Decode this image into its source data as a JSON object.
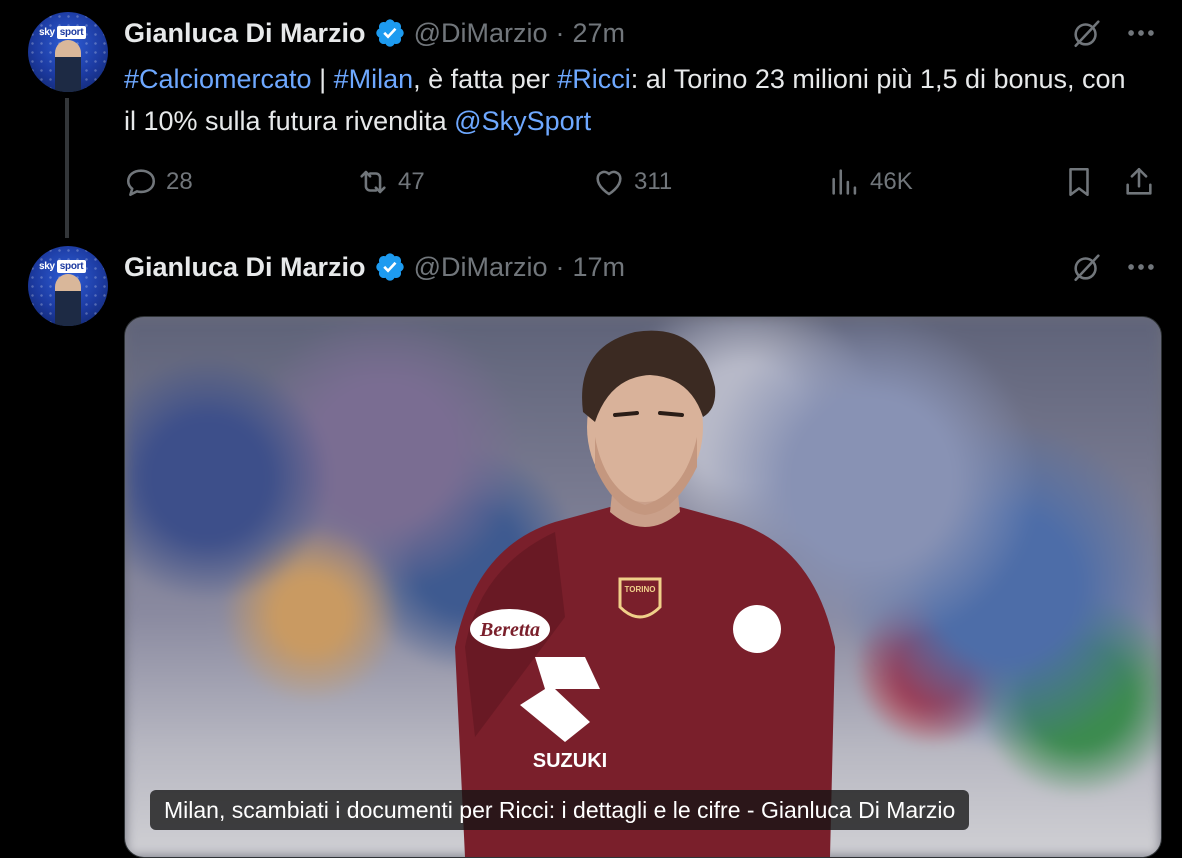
{
  "tweets": [
    {
      "author_name": "Gianluca Di Marzio",
      "handle": "@DiMarzio",
      "separator": "·",
      "time": "27m",
      "text_segments": [
        {
          "text": "#Calciomercato",
          "link": true
        },
        {
          "text": " | ",
          "link": false
        },
        {
          "text": "#Milan",
          "link": true
        },
        {
          "text": ", è fatta per ",
          "link": false
        },
        {
          "text": "#Ricci",
          "link": true
        },
        {
          "text": ": al Torino 23 milioni più 1,5 di bonus, con il 10% sulla futura rivendita ",
          "link": false
        },
        {
          "text": "@SkySport",
          "link": true
        }
      ],
      "actions": {
        "replies": "28",
        "reposts": "47",
        "likes": "311",
        "views": "46K"
      }
    },
    {
      "author_name": "Gianluca Di Marzio",
      "handle": "@DiMarzio",
      "separator": "·",
      "time": "17m",
      "media": {
        "card_title": "Milan, scambiati i documenti per Ricci: i dettagli e le cifre - Gianluca Di Marzio",
        "jersey_sponsor": "SUZUKI",
        "jersey_secondary_sponsor": "Beretta",
        "crest_text": "TORINO"
      }
    }
  ],
  "avatar": {
    "brand_left": "sky",
    "brand_right": "sport"
  },
  "icons": {
    "verified": "verified-badge-icon",
    "grok": "grok-icon",
    "more": "more-icon",
    "reply": "reply-icon",
    "repost": "repost-icon",
    "like": "like-icon",
    "views": "views-icon",
    "bookmark": "bookmark-icon",
    "share": "share-icon"
  },
  "colors": {
    "background": "#000000",
    "text": "#e7e9ea",
    "muted": "#71767b",
    "link": "#6ea8ff",
    "verified": "#1d9bf0",
    "jersey": "#7a1f2b"
  }
}
